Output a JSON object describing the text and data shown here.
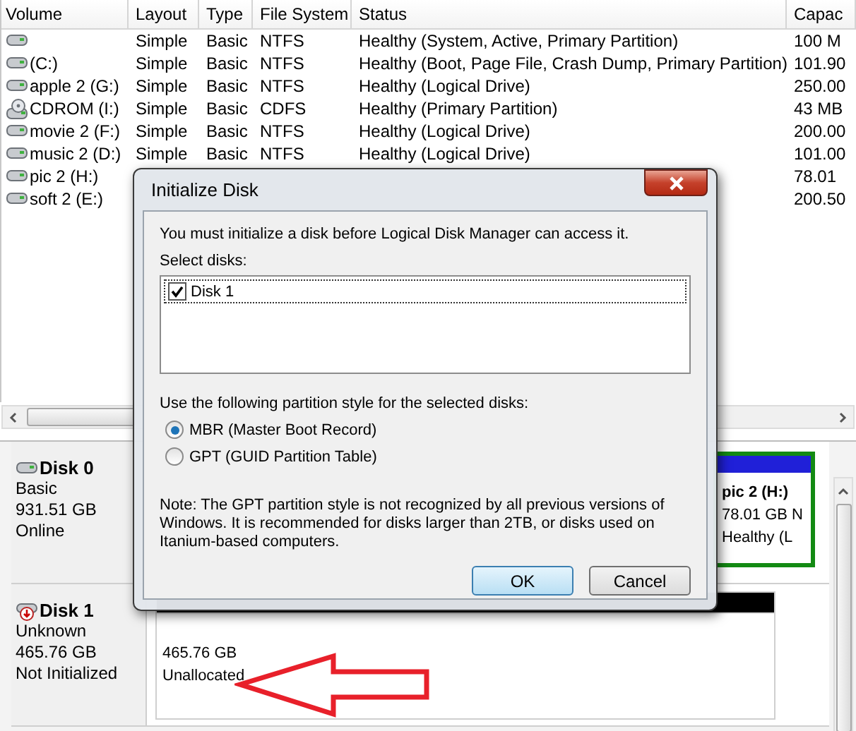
{
  "volume_list": {
    "columns": [
      "Volume",
      "Layout",
      "Type",
      "File System",
      "Status",
      "Capac"
    ],
    "rows": [
      {
        "kind": "hdd",
        "layout": "Simple",
        "type": "Basic",
        "file_system": "NTFS",
        "status": "Healthy (System, Active, Primary Partition)",
        "capacity": "100 M"
      },
      {
        "kind": "hdd",
        "volume": "(C:)",
        "layout": "Simple",
        "type": "Basic",
        "file_system": "NTFS",
        "status": "Healthy (Boot, Page File, Crash Dump, Primary Partition)",
        "capacity": "101.90"
      },
      {
        "kind": "hdd",
        "volume": "apple 2 (G:)",
        "layout": "Simple",
        "type": "Basic",
        "file_system": "NTFS",
        "status": "Healthy (Logical Drive)",
        "capacity": "250.00"
      },
      {
        "kind": "cdrom",
        "volume": "CDROM (I:)",
        "layout": "Simple",
        "type": "Basic",
        "file_system": "CDFS",
        "status": "Healthy (Primary Partition)",
        "capacity": "43 MB"
      },
      {
        "kind": "hdd",
        "volume": "movie 2 (F:)",
        "layout": "Simple",
        "type": "Basic",
        "file_system": "NTFS",
        "status": "Healthy (Logical Drive)",
        "capacity": "200.00"
      },
      {
        "kind": "hdd",
        "volume": "music 2 (D:)",
        "layout": "Simple",
        "type": "Basic",
        "file_system": "NTFS",
        "status": "Healthy (Logical Drive)",
        "capacity": "101.00"
      },
      {
        "kind": "hdd",
        "volume": "pic 2 (H:)",
        "capacity": "78.01"
      },
      {
        "kind": "hdd",
        "volume": "soft 2 (E:)",
        "capacity": "200.50"
      }
    ]
  },
  "disks": [
    {
      "kind": "online",
      "name": "Disk 0",
      "lines": [
        "Basic",
        "931.51 GB",
        "Online"
      ],
      "partitions": [
        {
          "kind": "logical",
          "name": "pic 2  (H:)",
          "size": "78.01 GB N",
          "status": "Healthy (L"
        }
      ]
    },
    {
      "kind": "uninitialized",
      "name": "Disk 1",
      "lines": [
        "Unknown",
        "465.76 GB",
        "Not Initialized"
      ],
      "partitions": [
        {
          "kind": "unallocated",
          "size": "465.76 GB",
          "status": "Unallocated"
        }
      ]
    }
  ],
  "dialog": {
    "title": "Initialize Disk",
    "message": "You must initialize a disk before Logical Disk Manager can access it.",
    "select_label": "Select disks:",
    "disks": [
      {
        "label": "Disk 1",
        "checked": true
      }
    ],
    "style_label": "Use the following partition style for the selected disks:",
    "styles": [
      {
        "label": "MBR (Master Boot Record)",
        "selected": true
      },
      {
        "label": "GPT (GUID Partition Table)",
        "selected": false
      }
    ],
    "note": "Note: The GPT partition style is not recognized by all previous versions of Windows. It is recommended for disks larger than 2TB, or disks used on Itanium-based computers.",
    "buttons": [
      {
        "label": "OK",
        "default": true
      },
      {
        "label": "Cancel",
        "default": false
      }
    ]
  }
}
